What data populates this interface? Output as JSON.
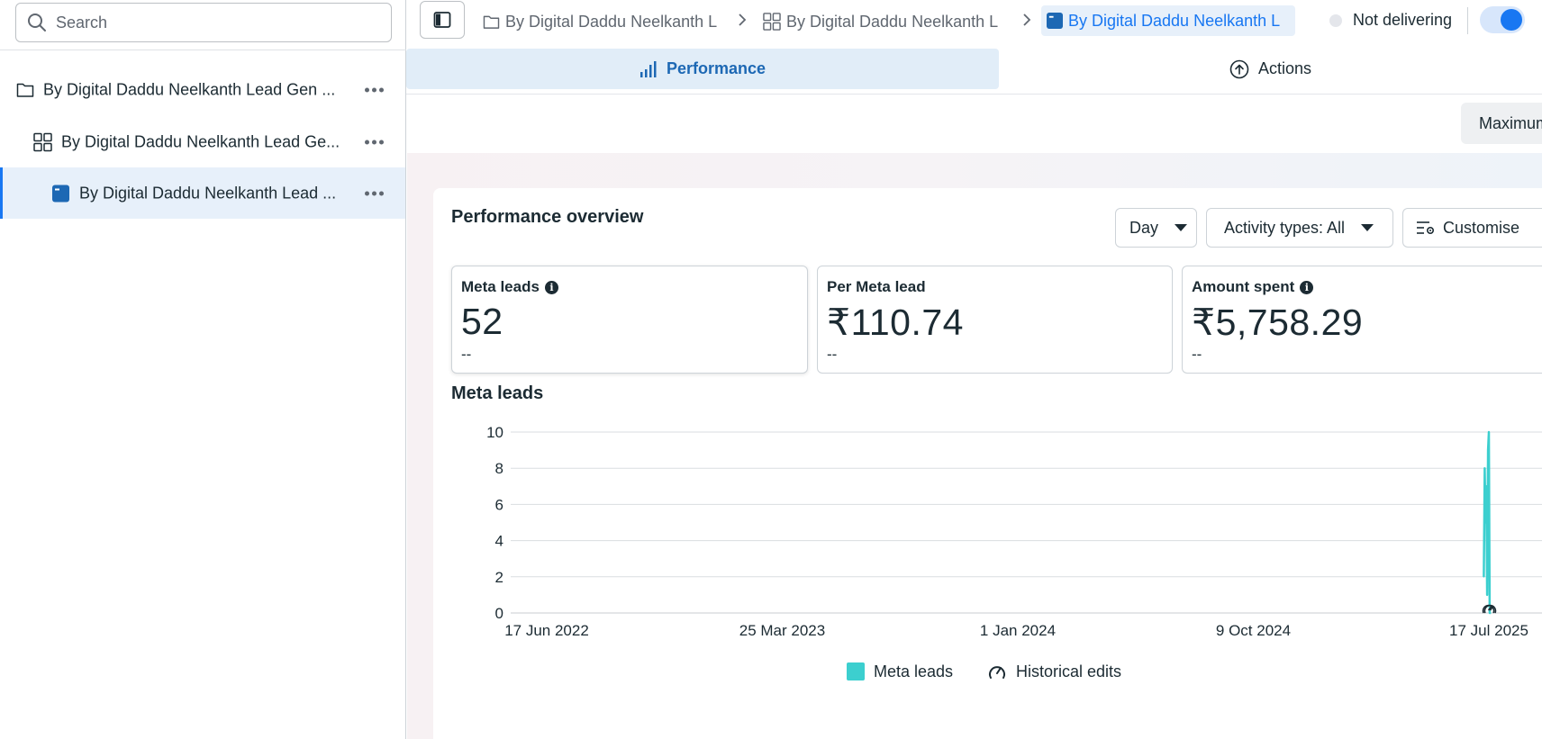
{
  "sidebar": {
    "search_placeholder": "Search",
    "items": [
      {
        "label": "By Digital Daddu Neelkanth Lead Gen ...",
        "icon": "folder-icon"
      },
      {
        "label": "By Digital Daddu Neelkanth Lead Ge...",
        "icon": "grid-icon"
      },
      {
        "label": "By Digital Daddu Neelkanth Lead ...",
        "icon": "ad-icon"
      }
    ]
  },
  "topbar": {
    "breadcrumbs": [
      {
        "label": "By Digital Daddu Neelkanth L",
        "icon": "folder-icon"
      },
      {
        "label": "By Digital Daddu Neelkanth L",
        "icon": "grid-icon"
      },
      {
        "label": "By Digital Daddu Neelkanth L",
        "icon": "ad-icon"
      }
    ],
    "status": "Not delivering"
  },
  "tabs": {
    "performance": "Performance",
    "actions": "Actions"
  },
  "maximum_label": "Maximum",
  "overview": {
    "title": "Performance overview",
    "day_label": "Day",
    "activity_label": "Activity types: All",
    "customise_label": "Customise"
  },
  "metrics": [
    {
      "label": "Meta leads",
      "value": "52",
      "delta": "--",
      "info": true
    },
    {
      "label": "Per Meta lead",
      "value": "₹110.74",
      "delta": "--",
      "info": false
    },
    {
      "label": "Amount spent",
      "value": "₹5,758.29",
      "delta": "--",
      "info": true
    }
  ],
  "chart_title": "Meta leads",
  "chart_data": {
    "type": "line",
    "title": "Meta leads",
    "xlabel": "",
    "ylabel": "",
    "ylim": [
      0,
      10
    ],
    "yticks": [
      "0",
      "2",
      "4",
      "6",
      "8",
      "10"
    ],
    "xticks": [
      "17 Jun 2022",
      "25 Mar 2023",
      "1 Jan 2024",
      "9 Oct 2024",
      "17 Jul 2025"
    ],
    "x_range": [
      "2022-06-17",
      "2025-07-17"
    ],
    "series": [
      {
        "name": "Meta leads",
        "color": "#3ccfcf",
        "x": [
          "2025-07-11",
          "2025-07-12",
          "2025-07-13",
          "2025-07-14",
          "2025-07-15",
          "2025-07-16",
          "2025-07-17",
          "2025-07-18",
          "2025-07-19"
        ],
        "y": [
          2,
          8,
          5,
          7,
          1,
          9,
          10,
          0,
          0
        ]
      }
    ],
    "historical_edits": [
      "2025-07-16",
      "2025-07-18"
    ],
    "grid": true,
    "legend": [
      "Meta leads",
      "Historical edits"
    ],
    "legend_position": "bottom"
  }
}
